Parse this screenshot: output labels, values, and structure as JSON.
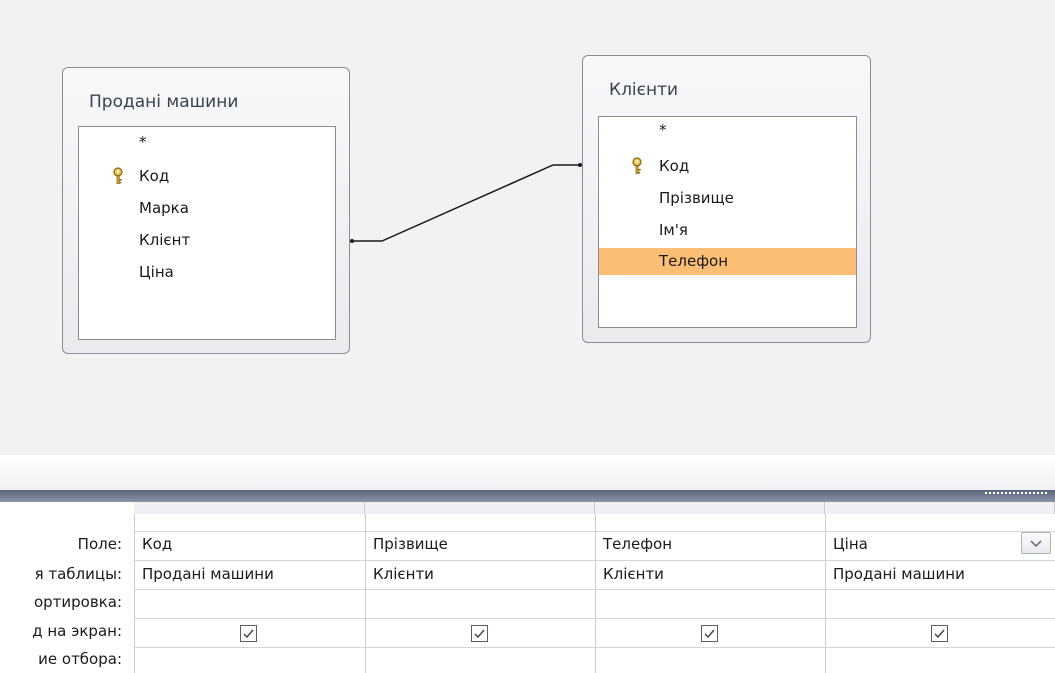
{
  "diagram": {
    "tables": [
      {
        "title": "Продані машини",
        "fields": [
          {
            "name": "*",
            "key": false
          },
          {
            "name": "Код",
            "key": true
          },
          {
            "name": "Марка",
            "key": false
          },
          {
            "name": "Клієнт",
            "key": false
          },
          {
            "name": "Ціна",
            "key": false
          }
        ]
      },
      {
        "title": "Клієнти",
        "fields": [
          {
            "name": "*",
            "key": false
          },
          {
            "name": "Код",
            "key": true
          },
          {
            "name": "Прізвище",
            "key": false
          },
          {
            "name": "Ім'я",
            "key": false
          },
          {
            "name": "Телефон",
            "key": false,
            "selected": true
          }
        ]
      }
    ],
    "relation": {
      "from_table": "Продані машини",
      "from_field": "Клієнт",
      "to_table": "Клієнти",
      "to_field": "Код"
    }
  },
  "grid": {
    "row_labels": [
      "Поле:",
      "я таблицы:",
      "ортировка:",
      "д на экран:",
      "ие отбора:"
    ],
    "columns": [
      {
        "field": "Код",
        "table": "Продані машини",
        "sort": "",
        "show": true
      },
      {
        "field": "Прізвище",
        "table": "Клієнти",
        "sort": "",
        "show": true
      },
      {
        "field": "Телефон",
        "table": "Клієнти",
        "sort": "",
        "show": true
      },
      {
        "field": "Ціна",
        "table": "Продані машини",
        "sort": "",
        "show": true,
        "has_dropdown": true
      }
    ]
  },
  "icons": {
    "key": "key-icon",
    "checkmark": "checkmark-icon",
    "dropdown": "chevron-down-icon"
  },
  "colors": {
    "selection": "#fbbe74",
    "pane_background": "#f0f2f4",
    "header_bar": "#5b6579"
  }
}
